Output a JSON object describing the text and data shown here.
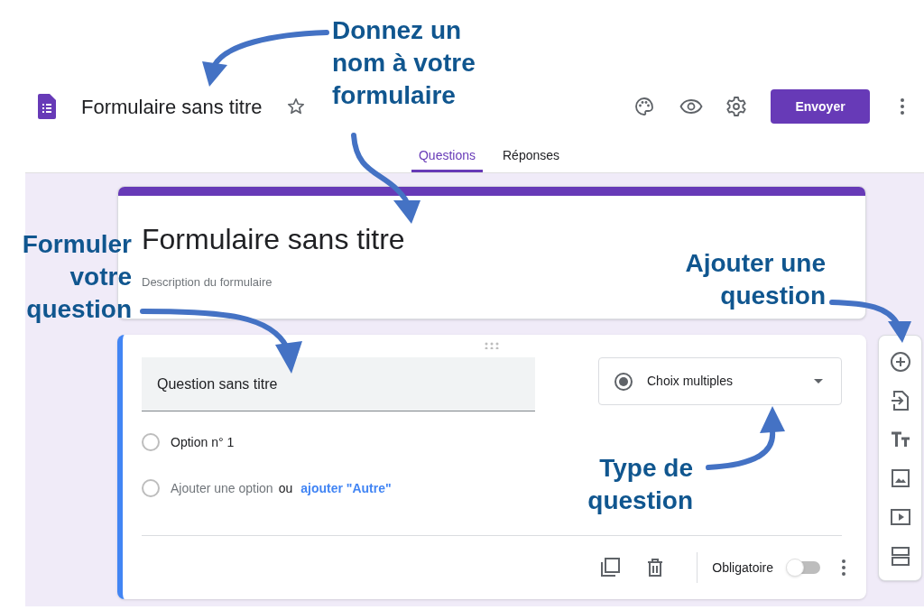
{
  "header": {
    "title": "Formulaire sans titre",
    "send_button": "Envoyer"
  },
  "tabs": [
    {
      "label": "Questions",
      "selected": true
    },
    {
      "label": "Réponses",
      "selected": false
    }
  ],
  "form": {
    "title": "Formulaire sans titre",
    "description_placeholder": "Description du formulaire"
  },
  "question": {
    "title": "Question sans titre",
    "type": "Choix multiples",
    "options": [
      "Option n° 1"
    ],
    "add_option": {
      "placeholder": "Ajouter une option",
      "separator": "ou",
      "link": "ajouter \"Autre\""
    },
    "required": {
      "label": "Obligatoire",
      "on": false
    }
  },
  "annotations": [
    {
      "kind": "name",
      "text": "Donnez un nom à votre formulaire"
    },
    {
      "kind": "question",
      "text": "Formuler votre question"
    },
    {
      "kind": "add",
      "text": "Ajouter une question"
    },
    {
      "kind": "type",
      "text": "Type de question"
    }
  ]
}
